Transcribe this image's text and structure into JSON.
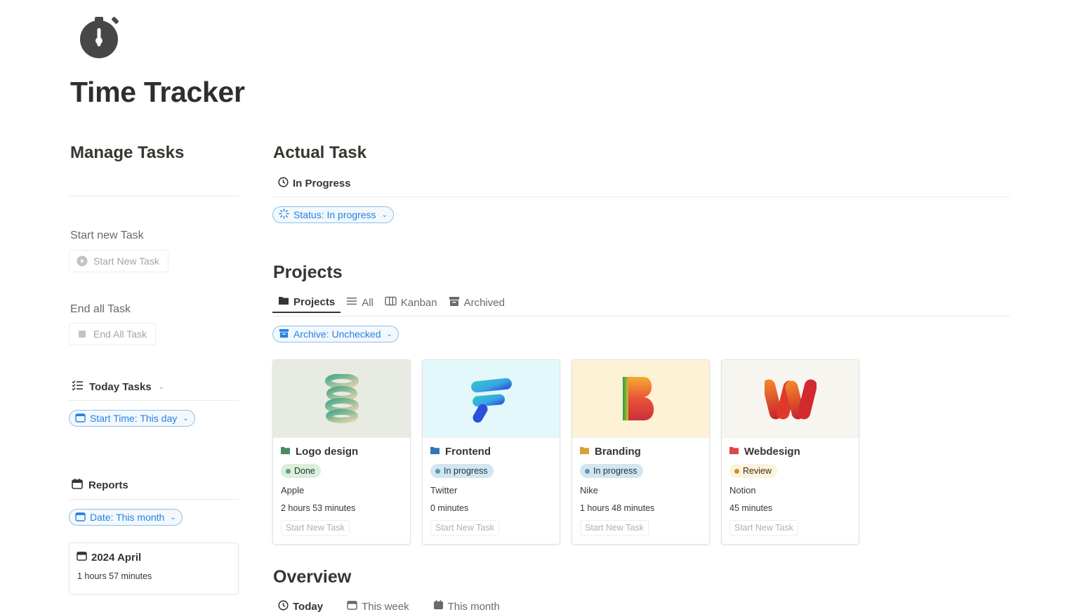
{
  "page": {
    "icon": "stopwatch-icon",
    "title": "Time Tracker"
  },
  "manage": {
    "title": "Manage Tasks",
    "start_label": "Start new Task",
    "start_button": "Start New Task",
    "end_label": "End all Task",
    "end_button": "End All Task",
    "today_view": "Today Tasks",
    "today_filter": "Start Time: This day",
    "reports_view": "Reports",
    "reports_filter": "Date: This month",
    "report_card": {
      "title": "2024 April",
      "duration": "1 hours 57 minutes"
    }
  },
  "actual": {
    "title": "Actual Task",
    "view": "In Progress",
    "filter": "Status: In progress"
  },
  "projects": {
    "title": "Projects",
    "tabs": [
      {
        "label": "Projects",
        "icon": "folder-icon",
        "active": true
      },
      {
        "label": "All",
        "icon": "list-icon",
        "active": false
      },
      {
        "label": "Kanban",
        "icon": "board-icon",
        "active": false
      },
      {
        "label": "Archived",
        "icon": "archive-icon",
        "active": false
      }
    ],
    "filter": "Archive: Unchecked",
    "cards": [
      {
        "title": "Logo design",
        "folder_color": "#4d8a63",
        "cover_bg": "#e8ebe2",
        "status": "Done",
        "status_bg": "#dbeddb",
        "status_fg": "#1c3829",
        "status_dot": "#6c9b7d",
        "client": "Apple",
        "time": "2 hours 53 minutes",
        "button": "Start New Task"
      },
      {
        "title": "Frontend",
        "folder_color": "#2f77b8",
        "cover_bg": "#e3f8fb",
        "status": "In progress",
        "status_bg": "#d3e5ef",
        "status_fg": "#183347",
        "status_dot": "#5b97bd",
        "client": "Twitter",
        "time": "0 minutes",
        "button": "Start New Task"
      },
      {
        "title": "Branding",
        "folder_color": "#d9a035",
        "cover_bg": "#fdf1d6",
        "status": "In progress",
        "status_bg": "#d3e5ef",
        "status_fg": "#183347",
        "status_dot": "#5b97bd",
        "client": "Nike",
        "time": "1 hours 48 minutes",
        "button": "Start New Task"
      },
      {
        "title": "Webdesign",
        "folder_color": "#d9484b",
        "cover_bg": "#f6f5f0",
        "status": "Review",
        "status_bg": "#fbf3db",
        "status_fg": "#402c1b",
        "status_dot": "#cb912f",
        "client": "Notion",
        "time": "45 minutes",
        "button": "Start New Task"
      }
    ]
  },
  "overview": {
    "title": "Overview",
    "tabs": [
      {
        "label": "Today",
        "icon": "clock-icon"
      },
      {
        "label": "This week",
        "icon": "calendar-icon"
      },
      {
        "label": "This month",
        "icon": "calendar-icon"
      }
    ]
  },
  "colors": {
    "accent": "#2383e2",
    "text": "#37352f",
    "muted": "#6b6a66"
  }
}
